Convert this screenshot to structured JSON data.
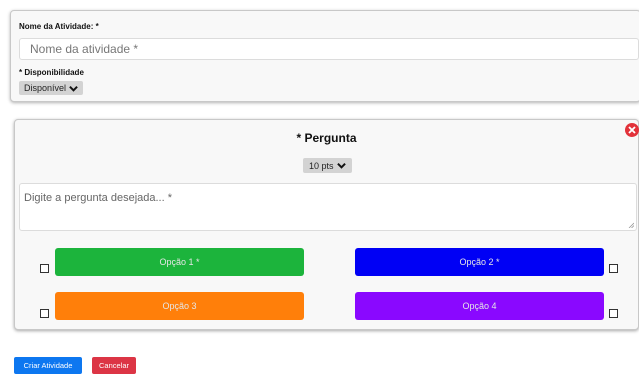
{
  "activity": {
    "name_label": "Nome da Atividade: *",
    "name_placeholder": "Nome da atividade *",
    "availability_label": "* Disponibilidade",
    "availability_value": "Disponível"
  },
  "question": {
    "title": "* Pergunta",
    "points_value": "10 pts",
    "text_placeholder": "Digite a pergunta desejada... *",
    "options": [
      {
        "label": "Opção 1 *",
        "color": "#1cb43c"
      },
      {
        "label": "Opção 2 *",
        "color": "#0000f5"
      },
      {
        "label": "Opção 3",
        "color": "#ff7f0a"
      },
      {
        "label": "Opção 4",
        "color": "#8a08ff"
      }
    ]
  },
  "footer": {
    "create_label": "Criar Atividade",
    "cancel_label": "Cancelar",
    "create_color": "#0d77f0",
    "cancel_color": "#dc3545"
  }
}
